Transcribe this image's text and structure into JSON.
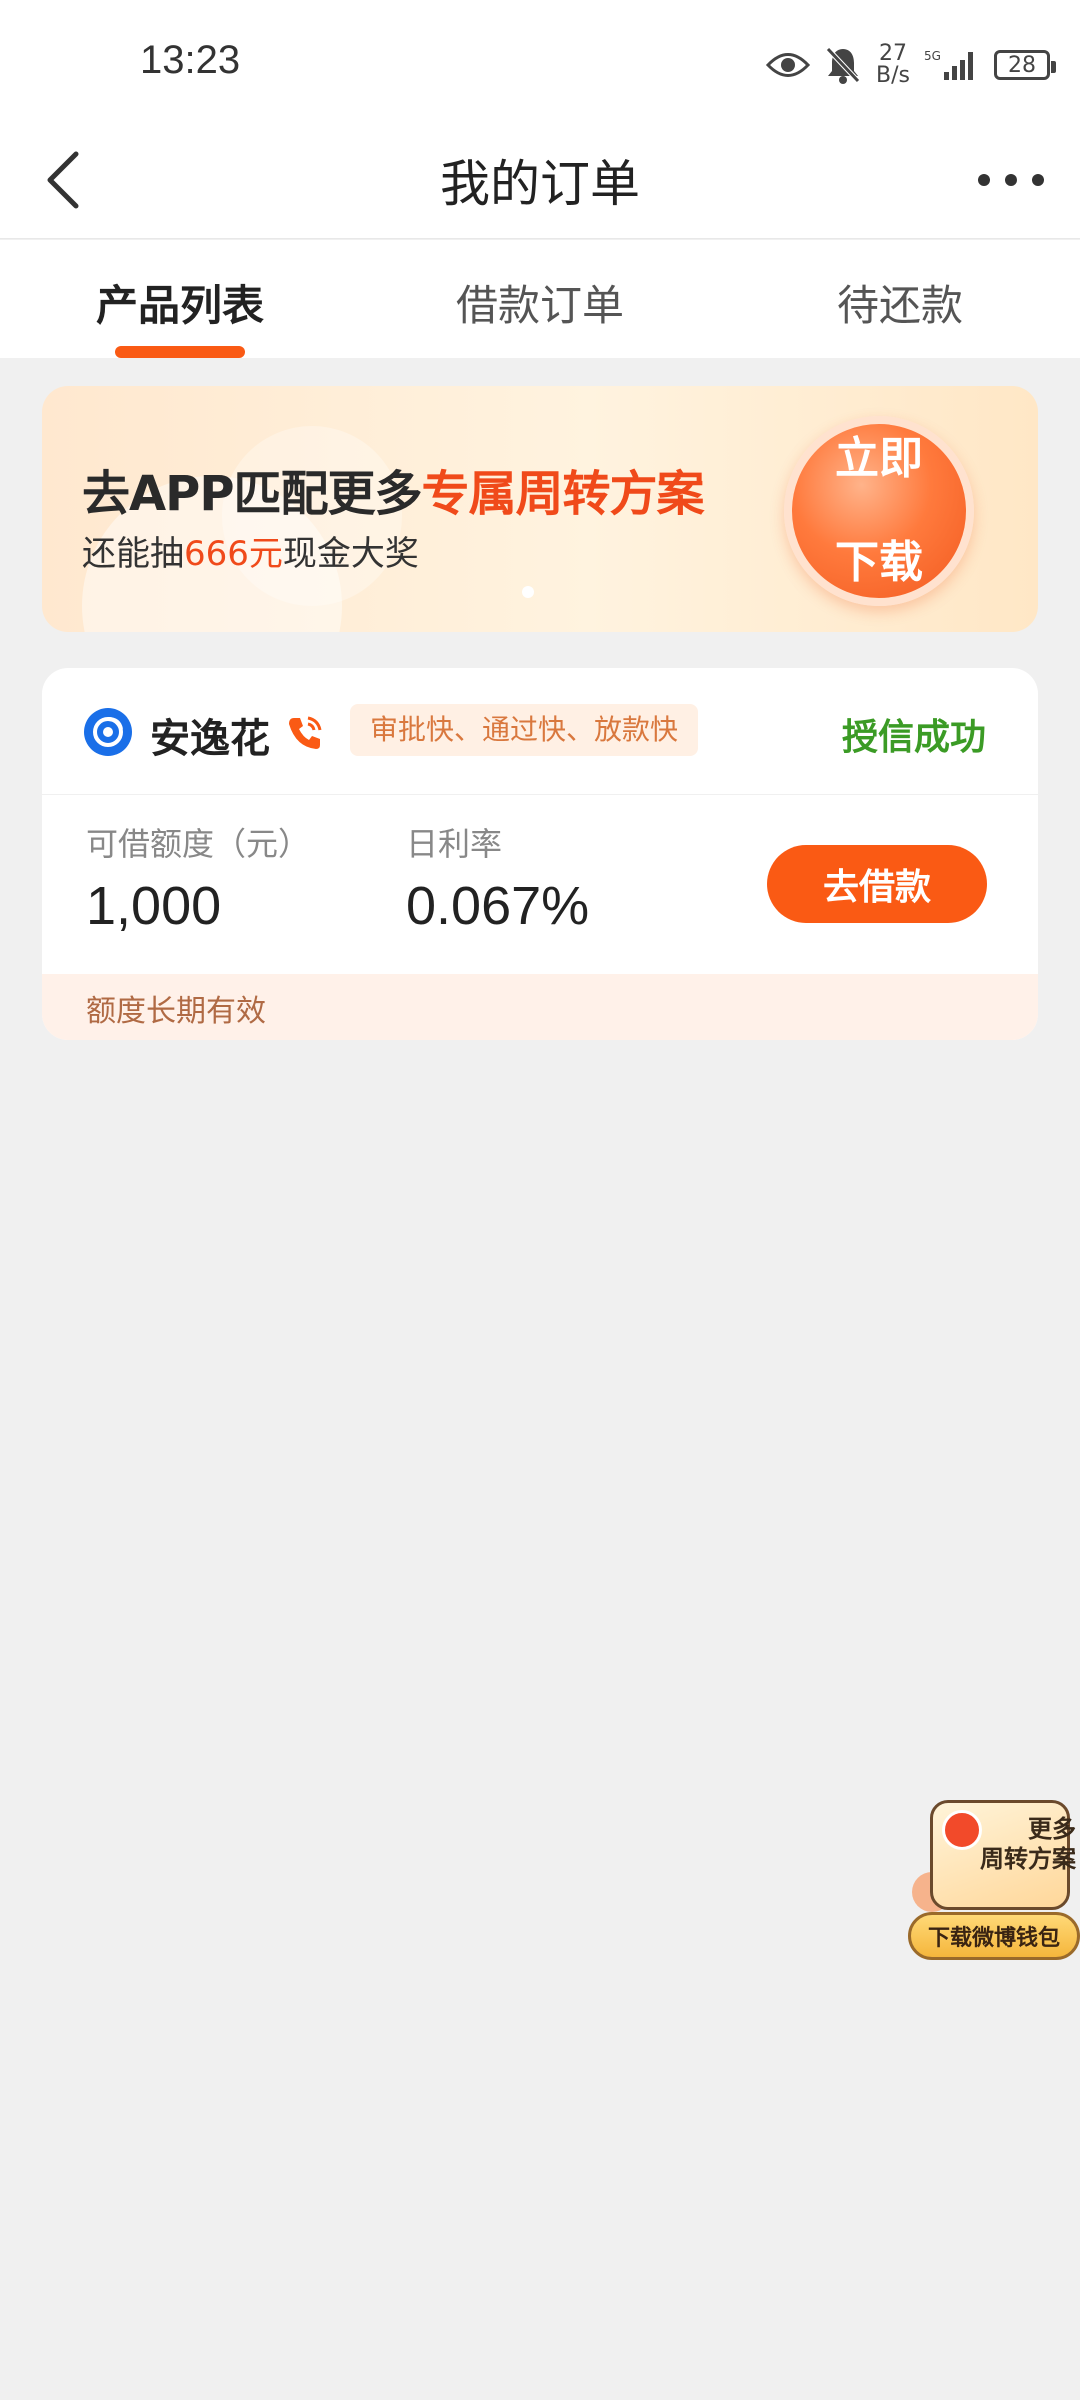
{
  "status_bar": {
    "time": "13:23",
    "net_speed_value": "27",
    "net_speed_unit": "B/s",
    "network_type": "5G",
    "battery_level": "28"
  },
  "header": {
    "title": "我的订单",
    "back_icon": "chevron-left-icon",
    "more_icon": "more-horizontal-icon"
  },
  "tabs": [
    {
      "label": "产品列表",
      "active": true
    },
    {
      "label": "借款订单",
      "active": false
    },
    {
      "label": "待还款",
      "active": false
    }
  ],
  "promo": {
    "title_part1": "去APP匹配更多",
    "title_part2": "专属周转方案",
    "sub_part1": "还能抽",
    "sub_part2": "666元",
    "sub_part3": "现金大奖",
    "button_line1": "立即",
    "button_line2": "下载"
  },
  "product": {
    "name": "安逸花",
    "tag": "审批快、通过快、放款快",
    "status": "授信成功",
    "limit_label": "可借额度（元）",
    "limit_value": "1,000",
    "rate_label": "日利率",
    "rate_value": "0.067%",
    "action_label": "去借款",
    "footer_note": "额度长期有效"
  },
  "float_widget": {
    "line1": "更多",
    "line2": "周转方案",
    "button_label": "下载微博钱包"
  },
  "colors": {
    "accent": "#fa5a14",
    "success": "#3b9b25",
    "brand_blue": "#1a6fe8",
    "page_bg": "#f0f0f0"
  }
}
